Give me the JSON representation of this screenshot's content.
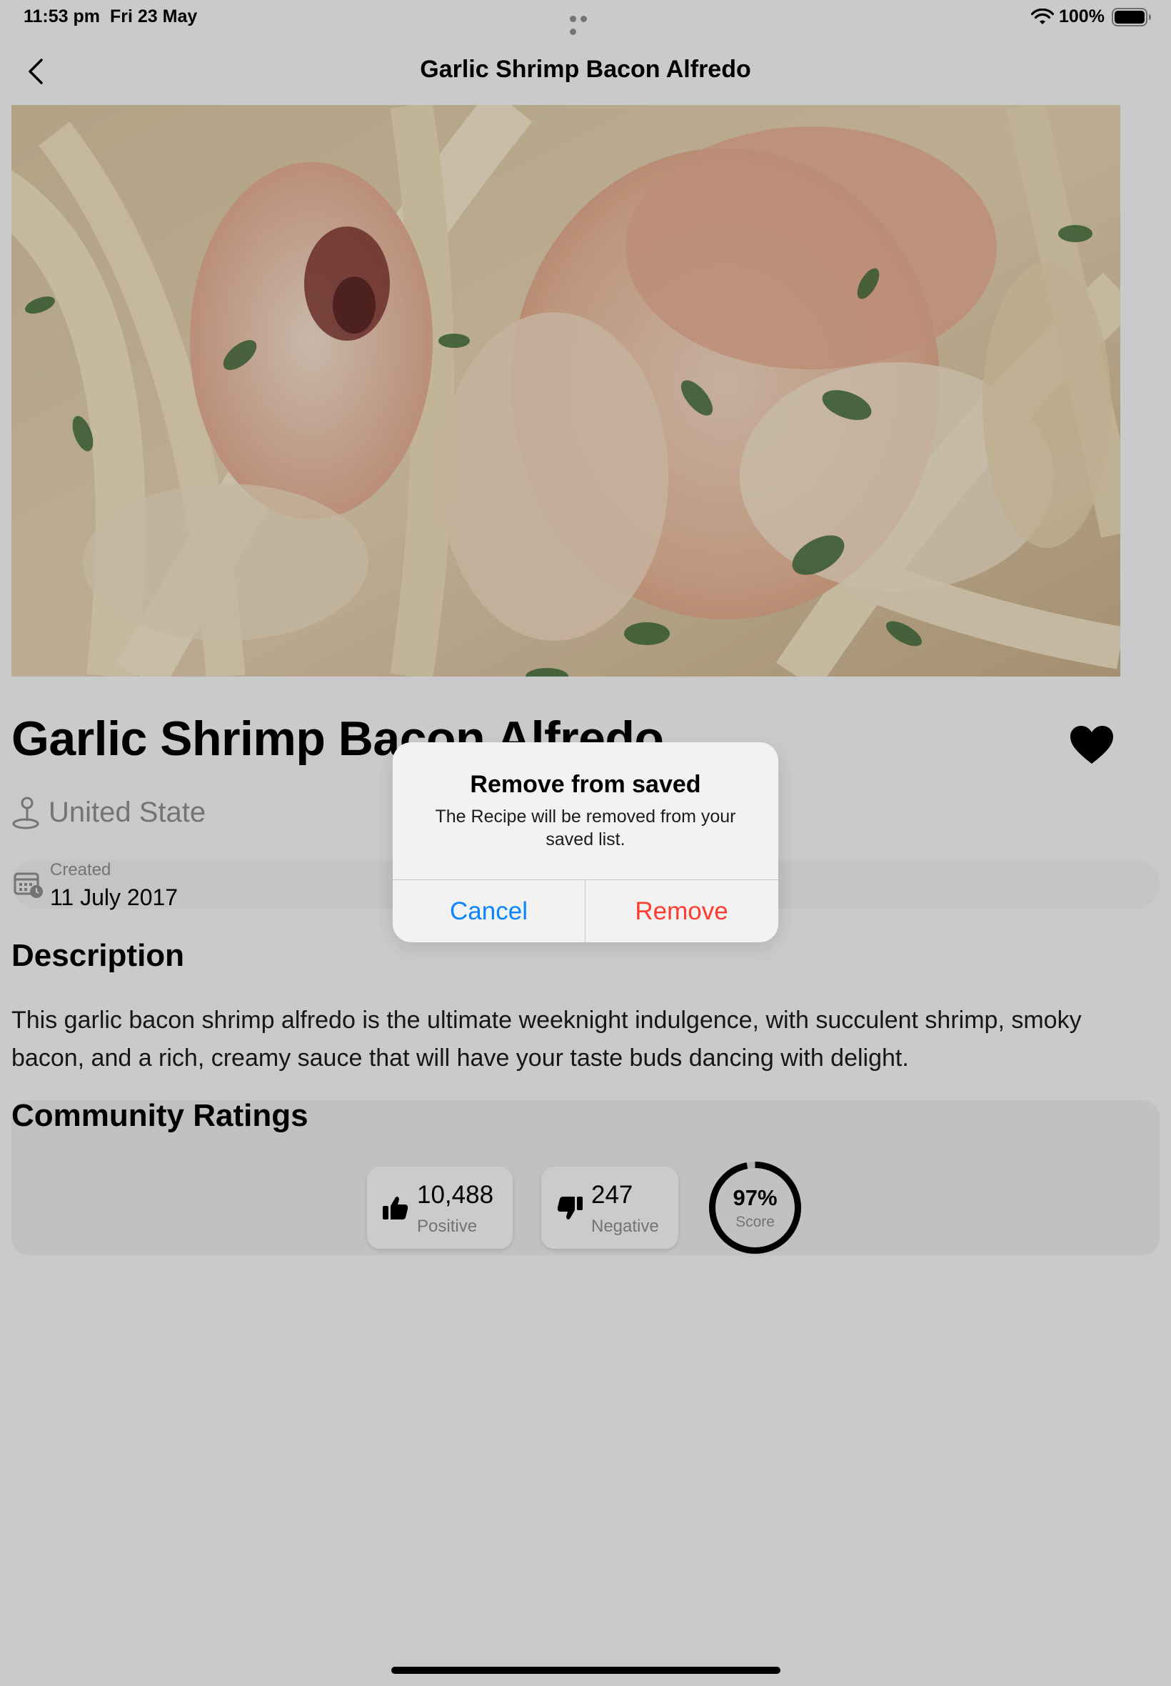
{
  "status_bar": {
    "time": "11:53 pm",
    "date": "Fri 23 May",
    "battery": "100%"
  },
  "nav": {
    "title": "Garlic Shrimp Bacon Alfredo",
    "back_icon": "chevron-left-icon"
  },
  "recipe": {
    "title": "Garlic Shrimp Bacon Alfredo",
    "is_favorite": true,
    "location": "United State",
    "created_label": "Created",
    "created_date": "11 July 2017"
  },
  "description": {
    "heading": "Description",
    "text": "This garlic bacon shrimp alfredo is the ultimate weeknight indulgence, with succulent shrimp, smoky bacon, and a rich, creamy sauce that will have your taste buds dancing with delight."
  },
  "ratings": {
    "heading": "Community Ratings",
    "positive_count": "10,488",
    "positive_label": "Positive",
    "negative_count": "247",
    "negative_label": "Negative",
    "score_value": "97%",
    "score_label": "Score",
    "score_fraction": 0.97
  },
  "alert": {
    "title": "Remove from saved",
    "message": "The Recipe will be removed from your saved list.",
    "cancel_label": "Cancel",
    "remove_label": "Remove"
  },
  "colors": {
    "accent_blue": "#0a84ff",
    "destructive_red": "#ff3b30",
    "secondary_text": "#8e8e93"
  }
}
